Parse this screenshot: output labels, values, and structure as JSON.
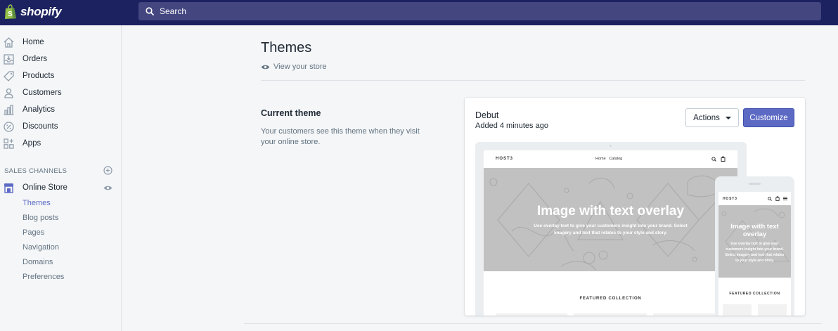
{
  "topbar": {
    "logo_text": "shopify",
    "search_placeholder": "Search"
  },
  "sidebar": {
    "items": [
      {
        "label": "Home",
        "icon": "home-icon"
      },
      {
        "label": "Orders",
        "icon": "orders-icon"
      },
      {
        "label": "Products",
        "icon": "tag-icon"
      },
      {
        "label": "Customers",
        "icon": "person-icon"
      },
      {
        "label": "Analytics",
        "icon": "bar-chart-icon"
      },
      {
        "label": "Discounts",
        "icon": "discount-icon"
      },
      {
        "label": "Apps",
        "icon": "apps-icon"
      }
    ],
    "sales_channels_label": "SALES CHANNELS",
    "online_store_label": "Online Store",
    "sub_items": [
      "Themes",
      "Blog posts",
      "Pages",
      "Navigation",
      "Domains",
      "Preferences"
    ],
    "active_sub_item": "Themes"
  },
  "main": {
    "title": "Themes",
    "view_store_label": "View your store",
    "current_theme_heading": "Current theme",
    "current_theme_desc": "Your customers see this theme when they visit your online store.",
    "theme": {
      "name": "Debut",
      "added": "Added 4 minutes ago",
      "actions_label": "Actions",
      "customize_label": "Customize"
    },
    "preview": {
      "brand": "HOST3",
      "nav_links": "Home   Catalog",
      "hero_title": "Image with text overlay",
      "hero_subtitle": "Use overlay text to give your customers insight into your brand. Select imagery and text that relates to your style and story.",
      "featured_label": "FEATURED COLLECTION"
    }
  },
  "colors": {
    "topbar_bg": "#1c2260",
    "search_bg": "#43467f",
    "accent": "#5c6ac4",
    "hero_gray": "#c1c1c1"
  }
}
